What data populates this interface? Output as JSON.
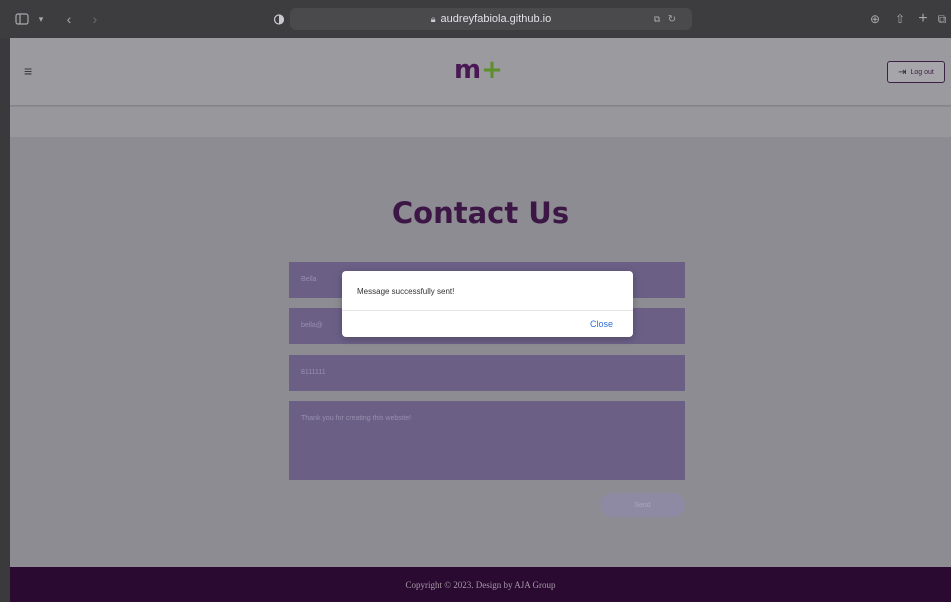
{
  "browser": {
    "url": "audreyfabiola.github.io",
    "icons": {
      "sidebar": "sidebar-icon",
      "back": "chevron-left-icon",
      "forward": "chevron-right-icon",
      "privacy": "shield-half-icon",
      "lock": "lock-icon",
      "translate": "translate-icon",
      "reload": "reload-icon",
      "download": "download-icon",
      "share": "share-icon",
      "new_tab": "plus-icon",
      "tabs": "tabs-icon"
    }
  },
  "nav": {
    "logo_main": "m",
    "logo_plus": "+",
    "logout_label": "Log out"
  },
  "page": {
    "title": "Contact Us",
    "fields": {
      "name": "Bella",
      "email": "bella@",
      "phone": "8111111",
      "message": "Thank you for creating this website!"
    },
    "send_label": "Send"
  },
  "modal": {
    "message": "Message successfully sent!",
    "close_label": "Close"
  },
  "footer": {
    "copyright": "Copyright © 2023. Design by AJA Group"
  },
  "colors": {
    "brand_purple": "#4a1854",
    "brand_green": "#5d8f2a",
    "footer_bg": "#2a0a31",
    "link_blue": "#2f6ed6"
  }
}
